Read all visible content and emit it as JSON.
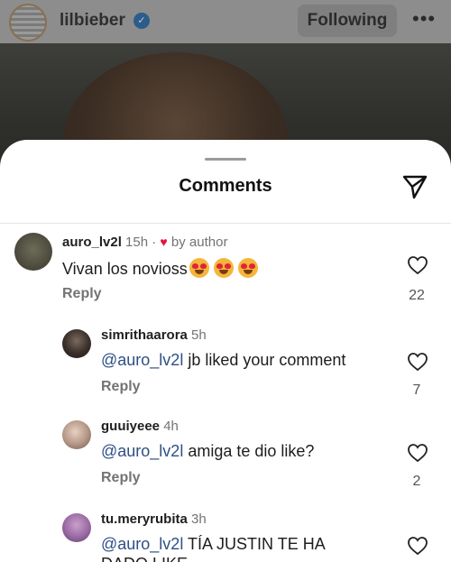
{
  "post": {
    "username": "lilbieber",
    "follow_label": "Following",
    "more_label": "•••"
  },
  "sheet": {
    "title": "Comments"
  },
  "colors": {
    "mention": "#2e4f86",
    "heart_red": "#e0143c",
    "meta_gray": "#737373"
  },
  "comments": [
    {
      "username": "auro_lv2l",
      "time": "15h",
      "separator": "·",
      "author_tag": "by author",
      "text": "Vivan los novioss",
      "emojis": "heart-eyes x3",
      "reply": "Reply",
      "likes": "22"
    },
    {
      "username": "simrithaarora",
      "time": "5h",
      "mention": "@auro_lv2l",
      "text": "jb liked your comment",
      "reply": "Reply",
      "likes": "7"
    },
    {
      "username": "guuiyeee",
      "time": "4h",
      "mention": "@auro_lv2l",
      "text": "amiga te dio like?",
      "reply": "Reply",
      "likes": "2"
    },
    {
      "username": "tu.meryrubita",
      "time": "3h",
      "mention": "@auro_lv2l",
      "text": "TÍA JUSTIN TE HA",
      "text_cont": "DADO LIKE"
    }
  ]
}
